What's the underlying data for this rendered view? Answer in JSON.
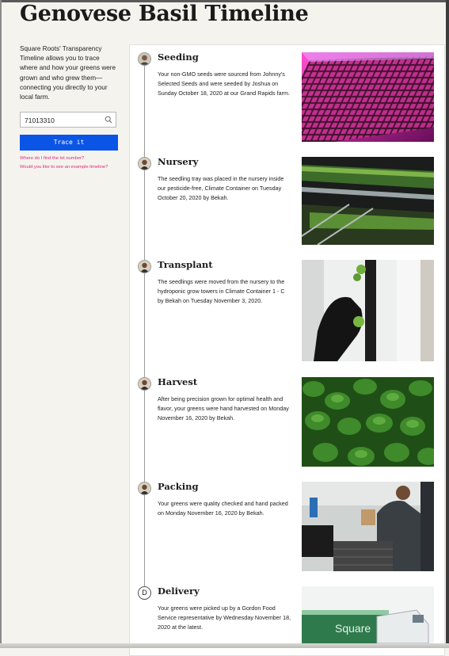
{
  "page": {
    "title": "Genovese Basil Timeline"
  },
  "sidebar": {
    "intro": "Square Roots' Transparency Timeline allows you to trace where and how your greens were grown and who grew them—connecting you directly to your local farm.",
    "search": {
      "value": "71013310"
    },
    "trace_button": "Trace it",
    "links": [
      "Where do I find the lot number?",
      "Would you like to see an example timeline?"
    ]
  },
  "colors": {
    "accent": "#0a55e6",
    "link": "#e0287e",
    "timeline": "#9c9c9c"
  },
  "timeline": [
    {
      "title": "Seeding",
      "avatar": "person-avatar-icon",
      "description": "Your non-GMO seeds were sourced from Johnny's Selected Seeds and were seeded by Joshua on Sunday October 18, 2020 at our Grand Rapids farm.",
      "photo": "seed-tray-under-pink-grow-light"
    },
    {
      "title": "Nursery",
      "avatar": "person-avatar-icon",
      "description": "The seedling tray was placed in the nursery inside our pesticide-free, Climate Container on Tuesday October 20, 2020 by Bekah.",
      "photo": "seedling-trays-on-rack"
    },
    {
      "title": "Transplant",
      "avatar": "person-avatar-icon",
      "description": "The seedlings were moved from the nursery to the hydroponic grow towers in Climate Container 1 - C by Bekah on Tuesday November 3, 2020.",
      "photo": "gloved-hand-placing-seedling-in-tower"
    },
    {
      "title": "Harvest",
      "avatar": "person-avatar-icon",
      "description": "After being precision grown for optimal health and flavor, your greens were hand harvested on Monday November 16, 2020 by Bekah.",
      "photo": "basil-leaves-closeup"
    },
    {
      "title": "Packing",
      "avatar": "person-avatar-icon",
      "description": "Your greens were quality checked and hand packed on Monday November 16, 2020 by Bekah.",
      "photo": "worker-packing-greens"
    },
    {
      "title": "Delivery",
      "avatar": "D",
      "description": "Your greens were picked up by a Gordon Food Service representative by Wednesday November 18, 2020 at the latest.",
      "photo": "delivery-van",
      "photo_text": "Square"
    }
  ]
}
